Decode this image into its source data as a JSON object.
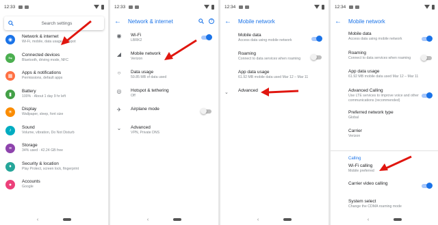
{
  "accent": "#1a73e8",
  "arrow_color": "#e0160f",
  "screens": {
    "settings": {
      "time": "12:33",
      "search_placeholder": "Search settings",
      "items": [
        {
          "title": "Network & internet",
          "subtitle": "Wi-Fi, mobile, data usage, hotspot",
          "icon": "wifi-icon",
          "color": "#1a73e8"
        },
        {
          "title": "Connected devices",
          "subtitle": "Bluetooth, driving mode, NFC",
          "icon": "devices-icon",
          "color": "#4caf50"
        },
        {
          "title": "Apps & notifications",
          "subtitle": "Permissions, default apps",
          "icon": "apps-icon",
          "color": "#ff7043"
        },
        {
          "title": "Battery",
          "subtitle": "100% · About 1 day 9 hr left",
          "icon": "battery-icon",
          "color": "#43a047"
        },
        {
          "title": "Display",
          "subtitle": "Wallpaper, sleep, font size",
          "icon": "display-icon",
          "color": "#fb8c00"
        },
        {
          "title": "Sound",
          "subtitle": "Volume, vibration, Do Not Disturb",
          "icon": "sound-icon",
          "color": "#00acc1"
        },
        {
          "title": "Storage",
          "subtitle": "34% used · 42.24 GB free",
          "icon": "storage-icon",
          "color": "#8e44ad"
        },
        {
          "title": "Security & location",
          "subtitle": "Play Protect, screen lock, fingerprint",
          "icon": "lock-icon",
          "color": "#26a69a"
        },
        {
          "title": "Accounts",
          "subtitle": "Google",
          "icon": "accounts-icon",
          "color": "#ec407a"
        }
      ]
    },
    "network": {
      "time": "12:33",
      "title": "Network & internet",
      "items": [
        {
          "title": "Wi-Fi",
          "subtitle": "LBRK2",
          "icon": "wifi-icon",
          "toggle": "on"
        },
        {
          "title": "Mobile network",
          "subtitle": "Verizon",
          "icon": "signal-icon",
          "toggle": "none"
        },
        {
          "title": "Data usage",
          "subtitle": "59.85 MB of data used",
          "icon": "data-usage-icon",
          "toggle": "none"
        },
        {
          "title": "Hotspot & tethering",
          "subtitle": "Off",
          "icon": "hotspot-icon",
          "toggle": "none"
        },
        {
          "title": "Airplane mode",
          "subtitle": "",
          "icon": "airplane-icon",
          "toggle": "off"
        },
        {
          "title": "Advanced",
          "subtitle": "VPN, Private DNS",
          "icon": "chevron-down-icon",
          "toggle": "none"
        }
      ]
    },
    "mobile": {
      "time": "12:34",
      "title": "Mobile network",
      "items": [
        {
          "title": "Mobile data",
          "subtitle": "Access data using mobile network",
          "toggle": "on"
        },
        {
          "title": "Roaming",
          "subtitle": "Connect to data services when roaming",
          "toggle": "off"
        },
        {
          "title": "App data usage",
          "subtitle": "61.92 MB mobile data used Mar 12 – Mar 11",
          "toggle": "none"
        },
        {
          "title": "Advanced",
          "subtitle": "",
          "toggle": "none"
        }
      ]
    },
    "mobile_advanced": {
      "time": "12:34",
      "title": "Mobile network",
      "items": [
        {
          "title": "Mobile data",
          "subtitle": "Access data using mobile network",
          "toggle": "on"
        },
        {
          "title": "Roaming",
          "subtitle": "Connect to data services when roaming",
          "toggle": "off"
        },
        {
          "title": "App data usage",
          "subtitle": "61.92 MB mobile data used Mar 12 – Mar 11",
          "toggle": "none"
        },
        {
          "title": "Advanced Calling",
          "subtitle": "Use LTE services to improve voice and other communications (recommended)",
          "toggle": "on"
        },
        {
          "title": "Preferred network type",
          "subtitle": "Global",
          "toggle": "none"
        },
        {
          "title": "Carrier",
          "subtitle": "Verizon",
          "toggle": "none"
        }
      ],
      "section": "Calling",
      "calling_items": [
        {
          "title": "Wi-Fi calling",
          "subtitle": "Mobile preferred",
          "toggle": "none"
        },
        {
          "title": "Carrier video calling",
          "subtitle": "",
          "toggle": "on"
        },
        {
          "title": "System select",
          "subtitle": "Change the CDMA roaming mode",
          "toggle": "none"
        }
      ]
    }
  }
}
